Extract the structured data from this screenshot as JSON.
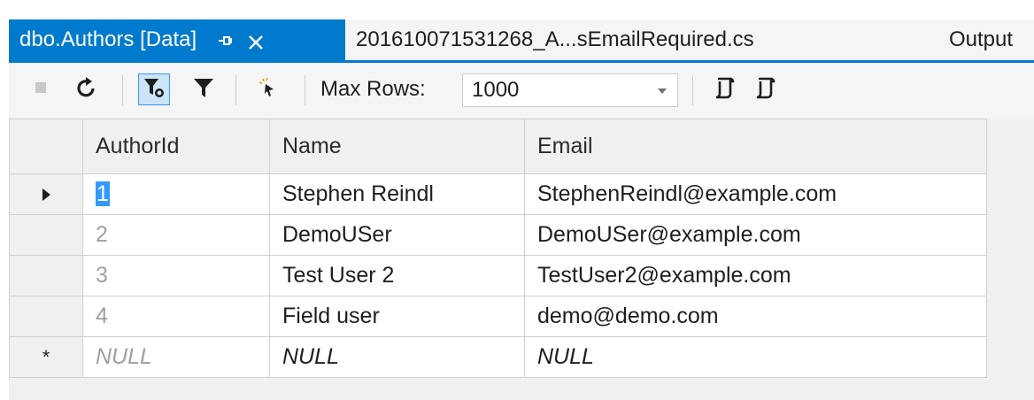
{
  "tabs": {
    "active_label": "dbo.Authors [Data]",
    "inactive_label": "201610071531268_A...sEmailRequired.cs",
    "output_label": "Output"
  },
  "toolbar": {
    "icons": [
      "stop-icon",
      "refresh-icon",
      "filter-toggle-icon",
      "filter-icon",
      "cursor-icon",
      "script-icon",
      "script-file-icon"
    ],
    "max_rows_label": "Max Rows:",
    "max_rows_value": "1000"
  },
  "colors": {
    "accent": "#007acc",
    "selection": "#3399ff",
    "muted_text": "#a0a0a0"
  },
  "grid": {
    "columns": [
      "AuthorId",
      "Name",
      "Email"
    ],
    "rows": [
      {
        "indicator": "current-row-arrow",
        "id": "1",
        "name": "Stephen Reindl",
        "email": "StephenReindl@example.com"
      },
      {
        "indicator": "",
        "id": "2",
        "name": "DemoUSer",
        "email": "DemoUSer@example.com"
      },
      {
        "indicator": "",
        "id": "3",
        "name": "Test User 2",
        "email": "TestUser2@example.com"
      },
      {
        "indicator": "",
        "id": "4",
        "name": "Field user",
        "email": "demo@demo.com"
      }
    ],
    "new_row": {
      "indicator": "*",
      "id": "NULL",
      "name": "NULL",
      "email": "NULL"
    }
  }
}
